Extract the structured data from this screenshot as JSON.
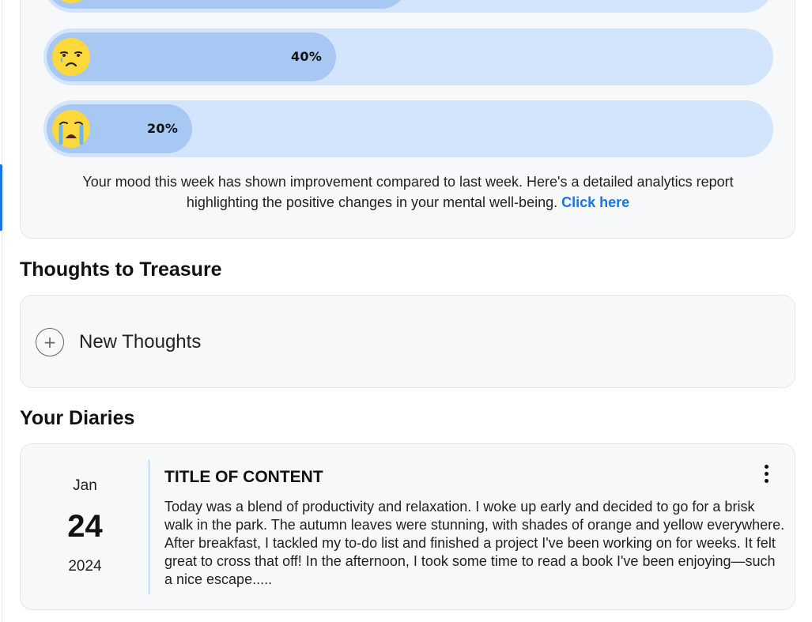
{
  "mood": {
    "bars": [
      {
        "emoji": "happy-emoji",
        "percent_label": "",
        "value": 0.5
      },
      {
        "emoji": "sad-emoji",
        "percent_label": "40%",
        "value": 0.4
      },
      {
        "emoji": "crying-emoji",
        "percent_label": "20%",
        "value": 0.2
      }
    ],
    "summary": "Your mood this week has shown improvement compared to last week. Here's a detailed analytics report highlighting the positive changes in your mental well-being.",
    "link_label": "Click here"
  },
  "thoughts": {
    "title": "Thoughts to Treasure",
    "new_button_label": "New Thoughts",
    "plus_glyph": "+"
  },
  "diaries": {
    "title": "Your Diaries",
    "entries": [
      {
        "month": "Jan",
        "day": "24",
        "year": "2024",
        "title": "TITLE OF CONTENT",
        "body": "Today was a blend of productivity and relaxation. I woke up early and decided to go for a brisk walk in the park. The autumn leaves were stunning, with shades of orange and yellow everywhere. After breakfast, I tackled my to-do list and finished a project I've been working on for weeks. It felt great to cross that off! In the afternoon, I took some time to read a book I've been enjoying—such a nice escape....."
      }
    ]
  },
  "colors": {
    "accent": "#1a73e8",
    "bar_track": "#d3e5fd",
    "bar_fill": "#a7c8f2",
    "emoji_yellow": "#ffd83b"
  }
}
